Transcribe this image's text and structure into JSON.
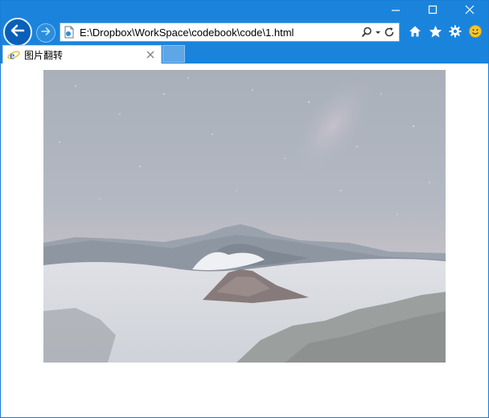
{
  "browser": {
    "address": "E:\\Dropbox\\WorkSpace\\codebook\\code\\1.html"
  },
  "tabs": [
    {
      "title": "图片翻转",
      "active": true
    }
  ],
  "icons": {
    "minimize": "minimize-icon",
    "maximize": "maximize-icon",
    "close": "close-icon",
    "back": "back-arrow-icon",
    "forward": "forward-arrow-icon",
    "page": "page-icon",
    "search": "search-icon",
    "dropdown": "dropdown-icon",
    "refresh": "refresh-icon",
    "home": "home-icon",
    "favorites": "star-icon",
    "tools": "gear-icon",
    "feedback": "smiley-icon",
    "tab_favicon": "ie-logo-icon",
    "tab_close": "tab-close-icon"
  },
  "colors": {
    "chrome": "#1a84dc",
    "back_button": "#0a5fb8",
    "new_tab": "#5ea6e6",
    "smiley": "#f4c430"
  },
  "content": {
    "image": "mountain-volcano-photo"
  }
}
